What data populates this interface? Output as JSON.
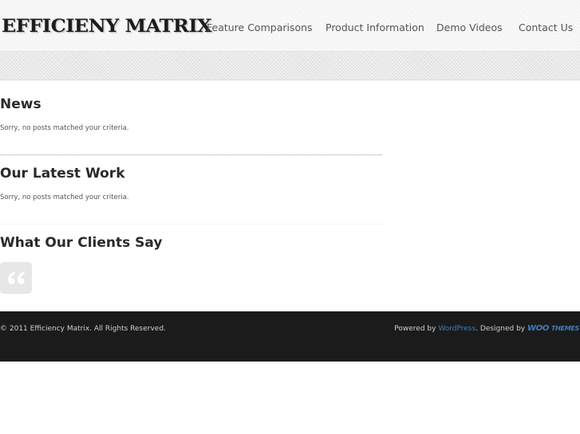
{
  "header": {
    "logo_text": "EFFICIENY MATRIX",
    "nav": [
      {
        "label": "Feature Comparisons"
      },
      {
        "label": "Product Information"
      },
      {
        "label": "Demo Videos"
      },
      {
        "label": "Contact Us"
      }
    ]
  },
  "sections": {
    "news": {
      "title": "News",
      "message": "Sorry, no posts matched your criteria."
    },
    "latest_work": {
      "title": "Our Latest Work",
      "message": "Sorry, no posts matched your criteria."
    },
    "testimonials": {
      "title": "What Our Clients Say"
    }
  },
  "footer": {
    "copyright": "© 2011 Efficiency Matrix. All Rights Reserved.",
    "powered_by_prefix": "Powered by",
    "powered_by_link": "WordPress",
    "designed_by_prefix": ". Designed by",
    "designer_logo_woo": "WOO",
    "designer_logo_themes": "THEMES"
  },
  "colors": {
    "footer_background": "#1b1b1b",
    "link": "#3f7fba",
    "heading": "#2a2a2a"
  },
  "icons": {
    "quote": "quote-icon"
  }
}
